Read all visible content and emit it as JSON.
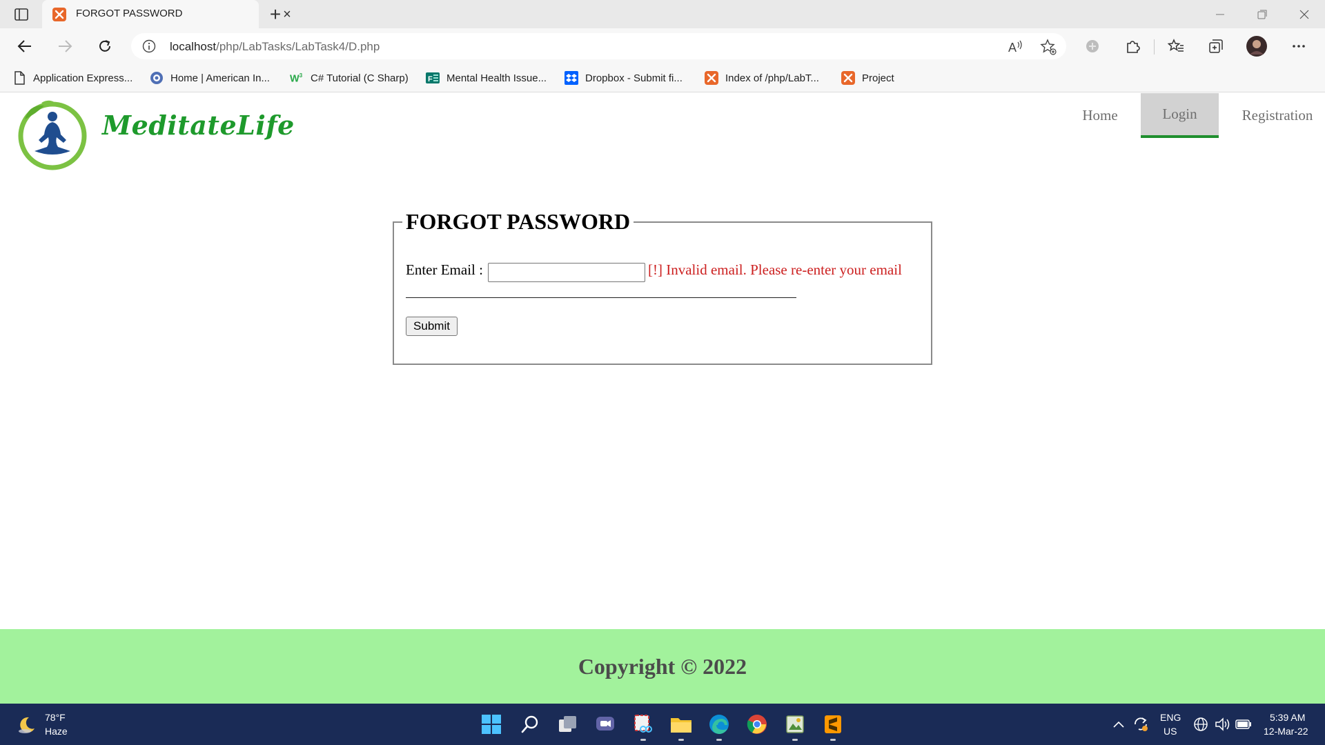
{
  "browser": {
    "tab_title": "FORGOT PASSWORD",
    "tab_close": "×",
    "new_tab": "+",
    "url_host": "localhost",
    "url_path": "/php/LabTasks/LabTask4/D.php",
    "bookmarks": [
      {
        "label": "Application Express...",
        "icon": "page-icon"
      },
      {
        "label": "Home | American In...",
        "icon": "globe-icon"
      },
      {
        "label": "C# Tutorial (C Sharp)",
        "icon": "w3schools-icon"
      },
      {
        "label": "Mental Health Issue...",
        "icon": "forms-icon"
      },
      {
        "label": "Dropbox - Submit fi...",
        "icon": "dropbox-icon"
      },
      {
        "label": "Index of /php/LabT...",
        "icon": "xampp-icon"
      },
      {
        "label": "Project",
        "icon": "xampp-icon"
      }
    ]
  },
  "site": {
    "logo_text": "MeditateLife",
    "nav": [
      {
        "label": "Home",
        "active": false
      },
      {
        "label": "Login",
        "active": true
      },
      {
        "label": "Registration",
        "active": false
      }
    ]
  },
  "form": {
    "legend": "FORGOT PASSWORD",
    "email_label": "Enter Email :",
    "email_value": "",
    "error": "[!] Invalid email. Please re-enter your email",
    "submit_label": "Submit"
  },
  "footer": {
    "copyright": "Copyright © 2022"
  },
  "taskbar": {
    "weather_temp": "78°F",
    "weather_condition": "Haze",
    "language_line1": "ENG",
    "language_line2": "US",
    "time": "5:39 AM",
    "date": "12-Mar-22"
  },
  "colors": {
    "accent_green": "#1f8f2e",
    "footer_bg": "#a2f29c",
    "error_red": "#cc1f1f",
    "taskbar_bg": "#1a2b56"
  }
}
